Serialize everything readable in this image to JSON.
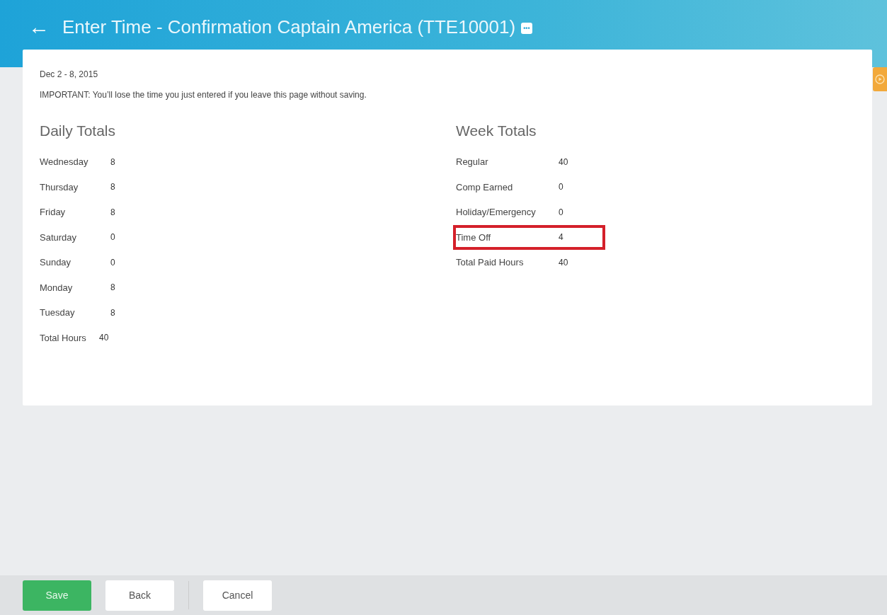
{
  "header": {
    "back": "←",
    "title": "Enter Time - Confirmation  Captain America (TTE10001)",
    "more": "•••"
  },
  "period": "Dec 2 - 8, 2015",
  "notice": "IMPORTANT: You’ll lose the time you just entered if you leave this page without saving.",
  "daily_totals": {
    "title": "Daily Totals",
    "rows": [
      {
        "label": "Wednesday",
        "value": "8"
      },
      {
        "label": "Thursday",
        "value": "8"
      },
      {
        "label": "Friday",
        "value": "8"
      },
      {
        "label": "Saturday",
        "value": "0"
      },
      {
        "label": "Sunday",
        "value": "0"
      },
      {
        "label": "Monday",
        "value": "8"
      },
      {
        "label": "Tuesday",
        "value": "8"
      },
      {
        "label": "Total Hours",
        "value": "40"
      }
    ]
  },
  "week_totals": {
    "title": "Week Totals",
    "rows": [
      {
        "label": "Regular",
        "value": "40",
        "highlighted": false
      },
      {
        "label": "Comp Earned",
        "value": "0",
        "highlighted": false
      },
      {
        "label": "Holiday/Emergency",
        "value": "0",
        "highlighted": false
      },
      {
        "label": "Time Off",
        "value": "4",
        "highlighted": true
      },
      {
        "label": "Total Paid Hours",
        "value": "40",
        "highlighted": false
      }
    ]
  },
  "footer": {
    "buttons": [
      {
        "label": "Save",
        "kind": "primary"
      },
      {
        "label": "Back",
        "kind": "secondary"
      },
      {
        "label": "Cancel",
        "kind": "secondary"
      }
    ]
  }
}
